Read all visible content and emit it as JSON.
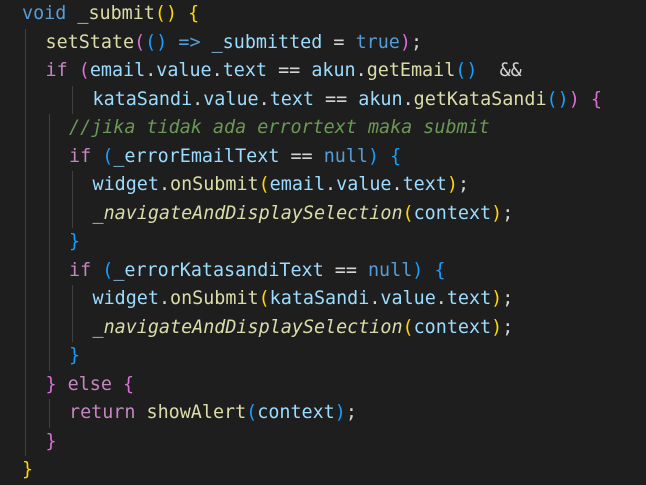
{
  "editor": {
    "language": "dart",
    "theme": {
      "background": "#1e1e1e",
      "indent_guide": "#404040"
    },
    "colors": {
      "keyword": "#c586c0",
      "type": "#569cd6",
      "function": "#dcdcaa",
      "variable": "#9cdcfe",
      "plain": "#d4d4d4",
      "comment": "#6a9955",
      "paren1": "#ffd700",
      "paren2": "#da70d6",
      "paren3": "#179fff"
    },
    "lines": [
      {
        "indent": 0,
        "tokens": [
          {
            "t": "void",
            "c": "type"
          },
          {
            "t": " ",
            "c": "plain"
          },
          {
            "t": "_submit",
            "c": "function"
          },
          {
            "t": "()",
            "c": "paren1"
          },
          {
            "t": " ",
            "c": "plain"
          },
          {
            "t": "{",
            "c": "paren1"
          }
        ]
      },
      {
        "indent": 1,
        "tokens": [
          {
            "t": "setState",
            "c": "function"
          },
          {
            "t": "(",
            "c": "paren2"
          },
          {
            "t": "()",
            "c": "paren3"
          },
          {
            "t": " => ",
            "c": "type"
          },
          {
            "t": "_submitted",
            "c": "variable"
          },
          {
            "t": " = ",
            "c": "plain"
          },
          {
            "t": "true",
            "c": "type"
          },
          {
            "t": ")",
            "c": "paren2"
          },
          {
            "t": ";",
            "c": "plain"
          }
        ]
      },
      {
        "indent": 1,
        "tokens": [
          {
            "t": "if",
            "c": "keyword"
          },
          {
            "t": " ",
            "c": "plain"
          },
          {
            "t": "(",
            "c": "paren2"
          },
          {
            "t": "email",
            "c": "variable"
          },
          {
            "t": ".",
            "c": "plain"
          },
          {
            "t": "value",
            "c": "variable"
          },
          {
            "t": ".",
            "c": "plain"
          },
          {
            "t": "text",
            "c": "variable"
          },
          {
            "t": " == ",
            "c": "plain"
          },
          {
            "t": "akun",
            "c": "variable"
          },
          {
            "t": ".",
            "c": "plain"
          },
          {
            "t": "getEmail",
            "c": "function"
          },
          {
            "t": "()",
            "c": "paren3"
          },
          {
            "t": "  &&",
            "c": "plain"
          }
        ]
      },
      {
        "indent": 3,
        "tokens": [
          {
            "t": "kataSandi",
            "c": "variable"
          },
          {
            "t": ".",
            "c": "plain"
          },
          {
            "t": "value",
            "c": "variable"
          },
          {
            "t": ".",
            "c": "plain"
          },
          {
            "t": "text",
            "c": "variable"
          },
          {
            "t": " == ",
            "c": "plain"
          },
          {
            "t": "akun",
            "c": "variable"
          },
          {
            "t": ".",
            "c": "plain"
          },
          {
            "t": "getKataSandi",
            "c": "function"
          },
          {
            "t": "()",
            "c": "paren3"
          },
          {
            "t": ")",
            "c": "paren2"
          },
          {
            "t": " ",
            "c": "plain"
          },
          {
            "t": "{",
            "c": "paren2"
          }
        ]
      },
      {
        "indent": 2,
        "tokens": [
          {
            "t": "//jika tidak ada errortext maka submit",
            "c": "comment",
            "italic": true
          }
        ]
      },
      {
        "indent": 2,
        "tokens": [
          {
            "t": "if",
            "c": "keyword"
          },
          {
            "t": " ",
            "c": "plain"
          },
          {
            "t": "(",
            "c": "paren3"
          },
          {
            "t": "_errorEmailText",
            "c": "variable"
          },
          {
            "t": " == ",
            "c": "plain"
          },
          {
            "t": "null",
            "c": "type"
          },
          {
            "t": ")",
            "c": "paren3"
          },
          {
            "t": " ",
            "c": "plain"
          },
          {
            "t": "{",
            "c": "paren3"
          }
        ]
      },
      {
        "indent": 3,
        "tokens": [
          {
            "t": "widget",
            "c": "variable"
          },
          {
            "t": ".",
            "c": "plain"
          },
          {
            "t": "onSubmit",
            "c": "function"
          },
          {
            "t": "(",
            "c": "paren1"
          },
          {
            "t": "email",
            "c": "variable"
          },
          {
            "t": ".",
            "c": "plain"
          },
          {
            "t": "value",
            "c": "variable"
          },
          {
            "t": ".",
            "c": "plain"
          },
          {
            "t": "text",
            "c": "variable"
          },
          {
            "t": ")",
            "c": "paren1"
          },
          {
            "t": ";",
            "c": "plain"
          }
        ]
      },
      {
        "indent": 3,
        "tokens": [
          {
            "t": "_navigateAndDisplaySelection",
            "c": "function",
            "italic": true
          },
          {
            "t": "(",
            "c": "paren1"
          },
          {
            "t": "context",
            "c": "variable"
          },
          {
            "t": ")",
            "c": "paren1"
          },
          {
            "t": ";",
            "c": "plain"
          }
        ]
      },
      {
        "indent": 2,
        "tokens": [
          {
            "t": "}",
            "c": "paren3"
          }
        ]
      },
      {
        "indent": 2,
        "tokens": [
          {
            "t": "if",
            "c": "keyword"
          },
          {
            "t": " ",
            "c": "plain"
          },
          {
            "t": "(",
            "c": "paren3"
          },
          {
            "t": "_errorKatasandiText",
            "c": "variable"
          },
          {
            "t": " == ",
            "c": "plain"
          },
          {
            "t": "null",
            "c": "type"
          },
          {
            "t": ")",
            "c": "paren3"
          },
          {
            "t": " ",
            "c": "plain"
          },
          {
            "t": "{",
            "c": "paren3"
          }
        ]
      },
      {
        "indent": 3,
        "tokens": [
          {
            "t": "widget",
            "c": "variable"
          },
          {
            "t": ".",
            "c": "plain"
          },
          {
            "t": "onSubmit",
            "c": "function"
          },
          {
            "t": "(",
            "c": "paren1"
          },
          {
            "t": "kataSandi",
            "c": "variable"
          },
          {
            "t": ".",
            "c": "plain"
          },
          {
            "t": "value",
            "c": "variable"
          },
          {
            "t": ".",
            "c": "plain"
          },
          {
            "t": "text",
            "c": "variable"
          },
          {
            "t": ")",
            "c": "paren1"
          },
          {
            "t": ";",
            "c": "plain"
          }
        ]
      },
      {
        "indent": 3,
        "tokens": [
          {
            "t": "_navigateAndDisplaySelection",
            "c": "function",
            "italic": true
          },
          {
            "t": "(",
            "c": "paren1"
          },
          {
            "t": "context",
            "c": "variable"
          },
          {
            "t": ")",
            "c": "paren1"
          },
          {
            "t": ";",
            "c": "plain"
          }
        ]
      },
      {
        "indent": 2,
        "tokens": [
          {
            "t": "}",
            "c": "paren3"
          }
        ]
      },
      {
        "indent": 1,
        "tokens": [
          {
            "t": "}",
            "c": "paren2"
          },
          {
            "t": " ",
            "c": "plain"
          },
          {
            "t": "else",
            "c": "keyword"
          },
          {
            "t": " ",
            "c": "plain"
          },
          {
            "t": "{",
            "c": "paren2"
          }
        ]
      },
      {
        "indent": 2,
        "tokens": [
          {
            "t": "return",
            "c": "keyword"
          },
          {
            "t": " ",
            "c": "plain"
          },
          {
            "t": "showAlert",
            "c": "function"
          },
          {
            "t": "(",
            "c": "paren3"
          },
          {
            "t": "context",
            "c": "variable"
          },
          {
            "t": ")",
            "c": "paren3"
          },
          {
            "t": ";",
            "c": "plain"
          }
        ]
      },
      {
        "indent": 1,
        "tokens": [
          {
            "t": "}",
            "c": "paren2"
          }
        ]
      },
      {
        "indent": 0,
        "tokens": [
          {
            "t": "}",
            "c": "paren1"
          }
        ]
      }
    ]
  }
}
